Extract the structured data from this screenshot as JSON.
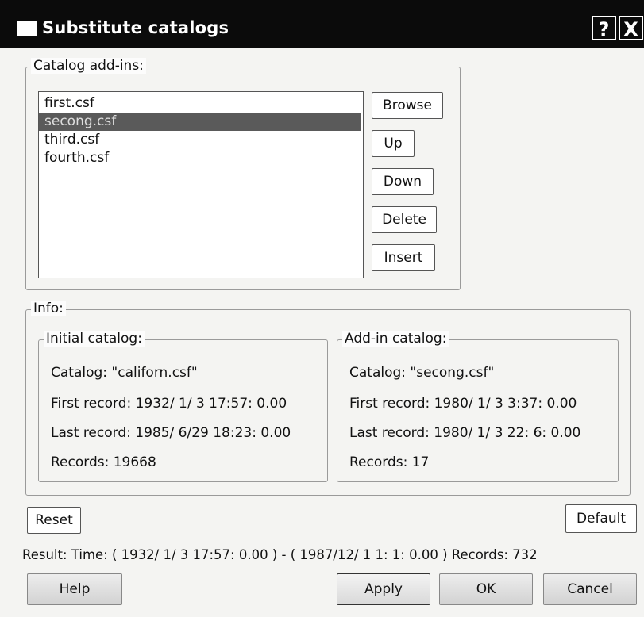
{
  "window": {
    "title": "Substitute catalogs",
    "help_glyph": "?",
    "close_glyph": "X",
    "icon": "window-icon"
  },
  "addins": {
    "legend": "Catalog add-ins:",
    "items": [
      "first.csf",
      "secong.csf",
      "third.csf",
      "fourth.csf"
    ],
    "selected_index": 1,
    "buttons": {
      "browse": "Browse",
      "up": "Up",
      "down": "Down",
      "delete": "Delete",
      "insert": "Insert"
    }
  },
  "info": {
    "legend": "Info:",
    "initial": {
      "legend": "Initial catalog:",
      "catalog": "Catalog: \"californ.csf\"",
      "first": "First record: 1932/ 1/ 3 17:57: 0.00",
      "last": "Last  record: 1985/ 6/29 18:23: 0.00",
      "records": "Records: 19668"
    },
    "addin": {
      "legend": "Add-in catalog:",
      "catalog": "Catalog: \"secong.csf\"",
      "first": "First record: 1980/ 1/ 3  3:37: 0.00",
      "last": "Last  record: 1980/ 1/ 3 22: 6: 0.00",
      "records": "Records: 17"
    }
  },
  "actions": {
    "reset": "Reset",
    "default": "Default",
    "result": "Result: Time: ( 1932/ 1/ 3 17:57: 0.00 ) - ( 1987/12/ 1  1: 1: 0.00 ) Records: 732",
    "help": "Help",
    "apply": "Apply",
    "ok": "OK",
    "cancel": "Cancel"
  },
  "colors": {
    "titlebar": "#0b0b0b",
    "selection": "#5a5a5a"
  }
}
